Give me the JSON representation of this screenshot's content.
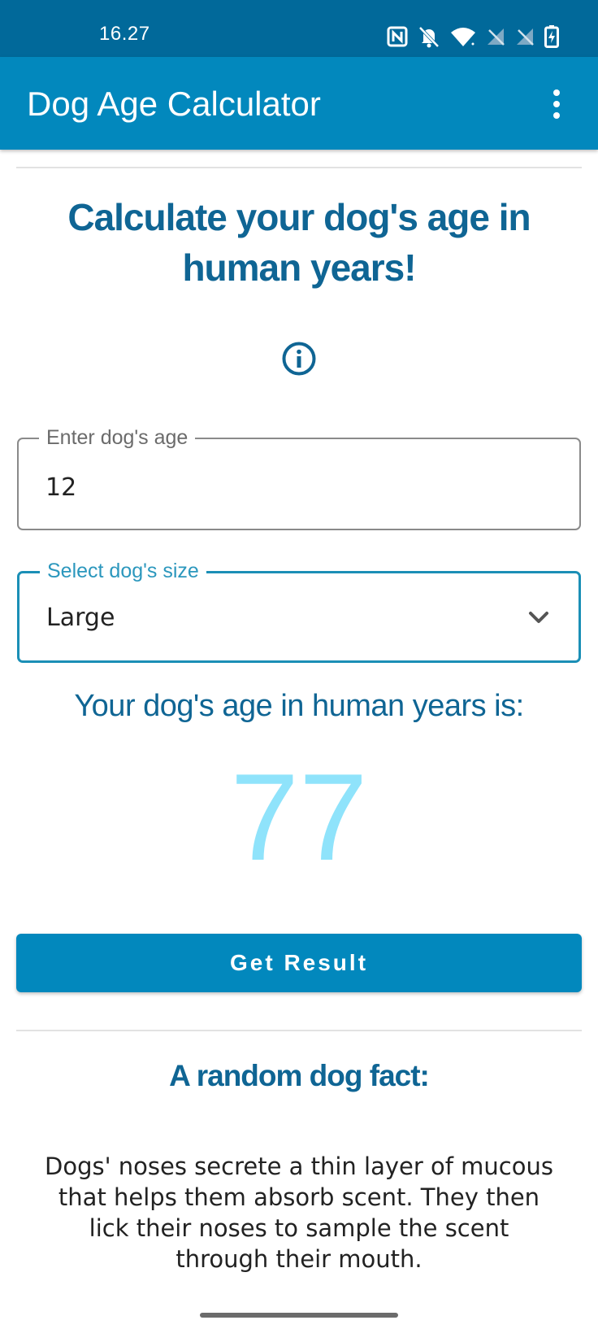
{
  "status_bar": {
    "time": "16.27",
    "icons": [
      "nfc-icon",
      "notifications-off-icon",
      "wifi-icon",
      "signal-off-icon",
      "signal-off-icon",
      "battery-charging-icon"
    ]
  },
  "app_bar": {
    "title": "Dog Age Calculator",
    "menu_icon": "more-vert-icon"
  },
  "main": {
    "headline": "Calculate your dog's age in human years!",
    "info_icon": "info-icon",
    "age_field": {
      "label": "Enter dog's age",
      "value": "12"
    },
    "size_field": {
      "label": "Select dog's size",
      "selected": "Large",
      "icon": "chevron-down-icon"
    },
    "result_label": "Your dog's age in human years is:",
    "result_value": "77",
    "button_label": "Get Result"
  },
  "fact": {
    "title": "A random dog fact:",
    "text": "Dogs' noses secrete a thin layer of mucous that helps them absorb scent. They then lick their noses to sample the scent through their mouth."
  },
  "colors": {
    "status_bar": "#01699a",
    "app_bar": "#0288bd",
    "heading_text": "#0f6594",
    "result_number": "#8fe3fb",
    "focused_outline": "#1b8fb6"
  }
}
